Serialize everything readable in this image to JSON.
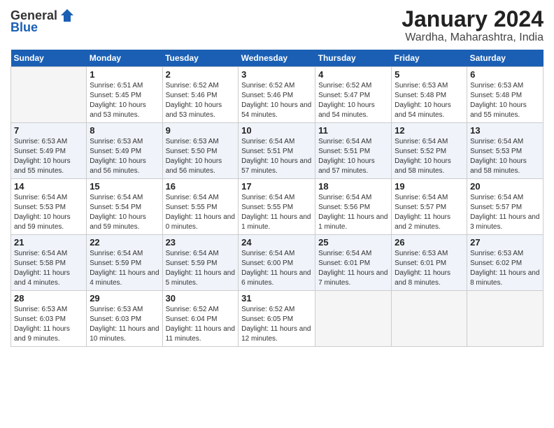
{
  "header": {
    "logo_general": "General",
    "logo_blue": "Blue",
    "title": "January 2024",
    "location": "Wardha, Maharashtra, India"
  },
  "days_of_week": [
    "Sunday",
    "Monday",
    "Tuesday",
    "Wednesday",
    "Thursday",
    "Friday",
    "Saturday"
  ],
  "weeks": [
    [
      {
        "num": "",
        "sunrise": "",
        "sunset": "",
        "daylight": ""
      },
      {
        "num": "1",
        "sunrise": "Sunrise: 6:51 AM",
        "sunset": "Sunset: 5:45 PM",
        "daylight": "Daylight: 10 hours and 53 minutes."
      },
      {
        "num": "2",
        "sunrise": "Sunrise: 6:52 AM",
        "sunset": "Sunset: 5:46 PM",
        "daylight": "Daylight: 10 hours and 53 minutes."
      },
      {
        "num": "3",
        "sunrise": "Sunrise: 6:52 AM",
        "sunset": "Sunset: 5:46 PM",
        "daylight": "Daylight: 10 hours and 54 minutes."
      },
      {
        "num": "4",
        "sunrise": "Sunrise: 6:52 AM",
        "sunset": "Sunset: 5:47 PM",
        "daylight": "Daylight: 10 hours and 54 minutes."
      },
      {
        "num": "5",
        "sunrise": "Sunrise: 6:53 AM",
        "sunset": "Sunset: 5:48 PM",
        "daylight": "Daylight: 10 hours and 54 minutes."
      },
      {
        "num": "6",
        "sunrise": "Sunrise: 6:53 AM",
        "sunset": "Sunset: 5:48 PM",
        "daylight": "Daylight: 10 hours and 55 minutes."
      }
    ],
    [
      {
        "num": "7",
        "sunrise": "Sunrise: 6:53 AM",
        "sunset": "Sunset: 5:49 PM",
        "daylight": "Daylight: 10 hours and 55 minutes."
      },
      {
        "num": "8",
        "sunrise": "Sunrise: 6:53 AM",
        "sunset": "Sunset: 5:49 PM",
        "daylight": "Daylight: 10 hours and 56 minutes."
      },
      {
        "num": "9",
        "sunrise": "Sunrise: 6:53 AM",
        "sunset": "Sunset: 5:50 PM",
        "daylight": "Daylight: 10 hours and 56 minutes."
      },
      {
        "num": "10",
        "sunrise": "Sunrise: 6:54 AM",
        "sunset": "Sunset: 5:51 PM",
        "daylight": "Daylight: 10 hours and 57 minutes."
      },
      {
        "num": "11",
        "sunrise": "Sunrise: 6:54 AM",
        "sunset": "Sunset: 5:51 PM",
        "daylight": "Daylight: 10 hours and 57 minutes."
      },
      {
        "num": "12",
        "sunrise": "Sunrise: 6:54 AM",
        "sunset": "Sunset: 5:52 PM",
        "daylight": "Daylight: 10 hours and 58 minutes."
      },
      {
        "num": "13",
        "sunrise": "Sunrise: 6:54 AM",
        "sunset": "Sunset: 5:53 PM",
        "daylight": "Daylight: 10 hours and 58 minutes."
      }
    ],
    [
      {
        "num": "14",
        "sunrise": "Sunrise: 6:54 AM",
        "sunset": "Sunset: 5:53 PM",
        "daylight": "Daylight: 10 hours and 59 minutes."
      },
      {
        "num": "15",
        "sunrise": "Sunrise: 6:54 AM",
        "sunset": "Sunset: 5:54 PM",
        "daylight": "Daylight: 10 hours and 59 minutes."
      },
      {
        "num": "16",
        "sunrise": "Sunrise: 6:54 AM",
        "sunset": "Sunset: 5:55 PM",
        "daylight": "Daylight: 11 hours and 0 minutes."
      },
      {
        "num": "17",
        "sunrise": "Sunrise: 6:54 AM",
        "sunset": "Sunset: 5:55 PM",
        "daylight": "Daylight: 11 hours and 1 minute."
      },
      {
        "num": "18",
        "sunrise": "Sunrise: 6:54 AM",
        "sunset": "Sunset: 5:56 PM",
        "daylight": "Daylight: 11 hours and 1 minute."
      },
      {
        "num": "19",
        "sunrise": "Sunrise: 6:54 AM",
        "sunset": "Sunset: 5:57 PM",
        "daylight": "Daylight: 11 hours and 2 minutes."
      },
      {
        "num": "20",
        "sunrise": "Sunrise: 6:54 AM",
        "sunset": "Sunset: 5:57 PM",
        "daylight": "Daylight: 11 hours and 3 minutes."
      }
    ],
    [
      {
        "num": "21",
        "sunrise": "Sunrise: 6:54 AM",
        "sunset": "Sunset: 5:58 PM",
        "daylight": "Daylight: 11 hours and 4 minutes."
      },
      {
        "num": "22",
        "sunrise": "Sunrise: 6:54 AM",
        "sunset": "Sunset: 5:59 PM",
        "daylight": "Daylight: 11 hours and 4 minutes."
      },
      {
        "num": "23",
        "sunrise": "Sunrise: 6:54 AM",
        "sunset": "Sunset: 5:59 PM",
        "daylight": "Daylight: 11 hours and 5 minutes."
      },
      {
        "num": "24",
        "sunrise": "Sunrise: 6:54 AM",
        "sunset": "Sunset: 6:00 PM",
        "daylight": "Daylight: 11 hours and 6 minutes."
      },
      {
        "num": "25",
        "sunrise": "Sunrise: 6:54 AM",
        "sunset": "Sunset: 6:01 PM",
        "daylight": "Daylight: 11 hours and 7 minutes."
      },
      {
        "num": "26",
        "sunrise": "Sunrise: 6:53 AM",
        "sunset": "Sunset: 6:01 PM",
        "daylight": "Daylight: 11 hours and 8 minutes."
      },
      {
        "num": "27",
        "sunrise": "Sunrise: 6:53 AM",
        "sunset": "Sunset: 6:02 PM",
        "daylight": "Daylight: 11 hours and 8 minutes."
      }
    ],
    [
      {
        "num": "28",
        "sunrise": "Sunrise: 6:53 AM",
        "sunset": "Sunset: 6:03 PM",
        "daylight": "Daylight: 11 hours and 9 minutes."
      },
      {
        "num": "29",
        "sunrise": "Sunrise: 6:53 AM",
        "sunset": "Sunset: 6:03 PM",
        "daylight": "Daylight: 11 hours and 10 minutes."
      },
      {
        "num": "30",
        "sunrise": "Sunrise: 6:52 AM",
        "sunset": "Sunset: 6:04 PM",
        "daylight": "Daylight: 11 hours and 11 minutes."
      },
      {
        "num": "31",
        "sunrise": "Sunrise: 6:52 AM",
        "sunset": "Sunset: 6:05 PM",
        "daylight": "Daylight: 11 hours and 12 minutes."
      },
      {
        "num": "",
        "sunrise": "",
        "sunset": "",
        "daylight": ""
      },
      {
        "num": "",
        "sunrise": "",
        "sunset": "",
        "daylight": ""
      },
      {
        "num": "",
        "sunrise": "",
        "sunset": "",
        "daylight": ""
      }
    ]
  ]
}
